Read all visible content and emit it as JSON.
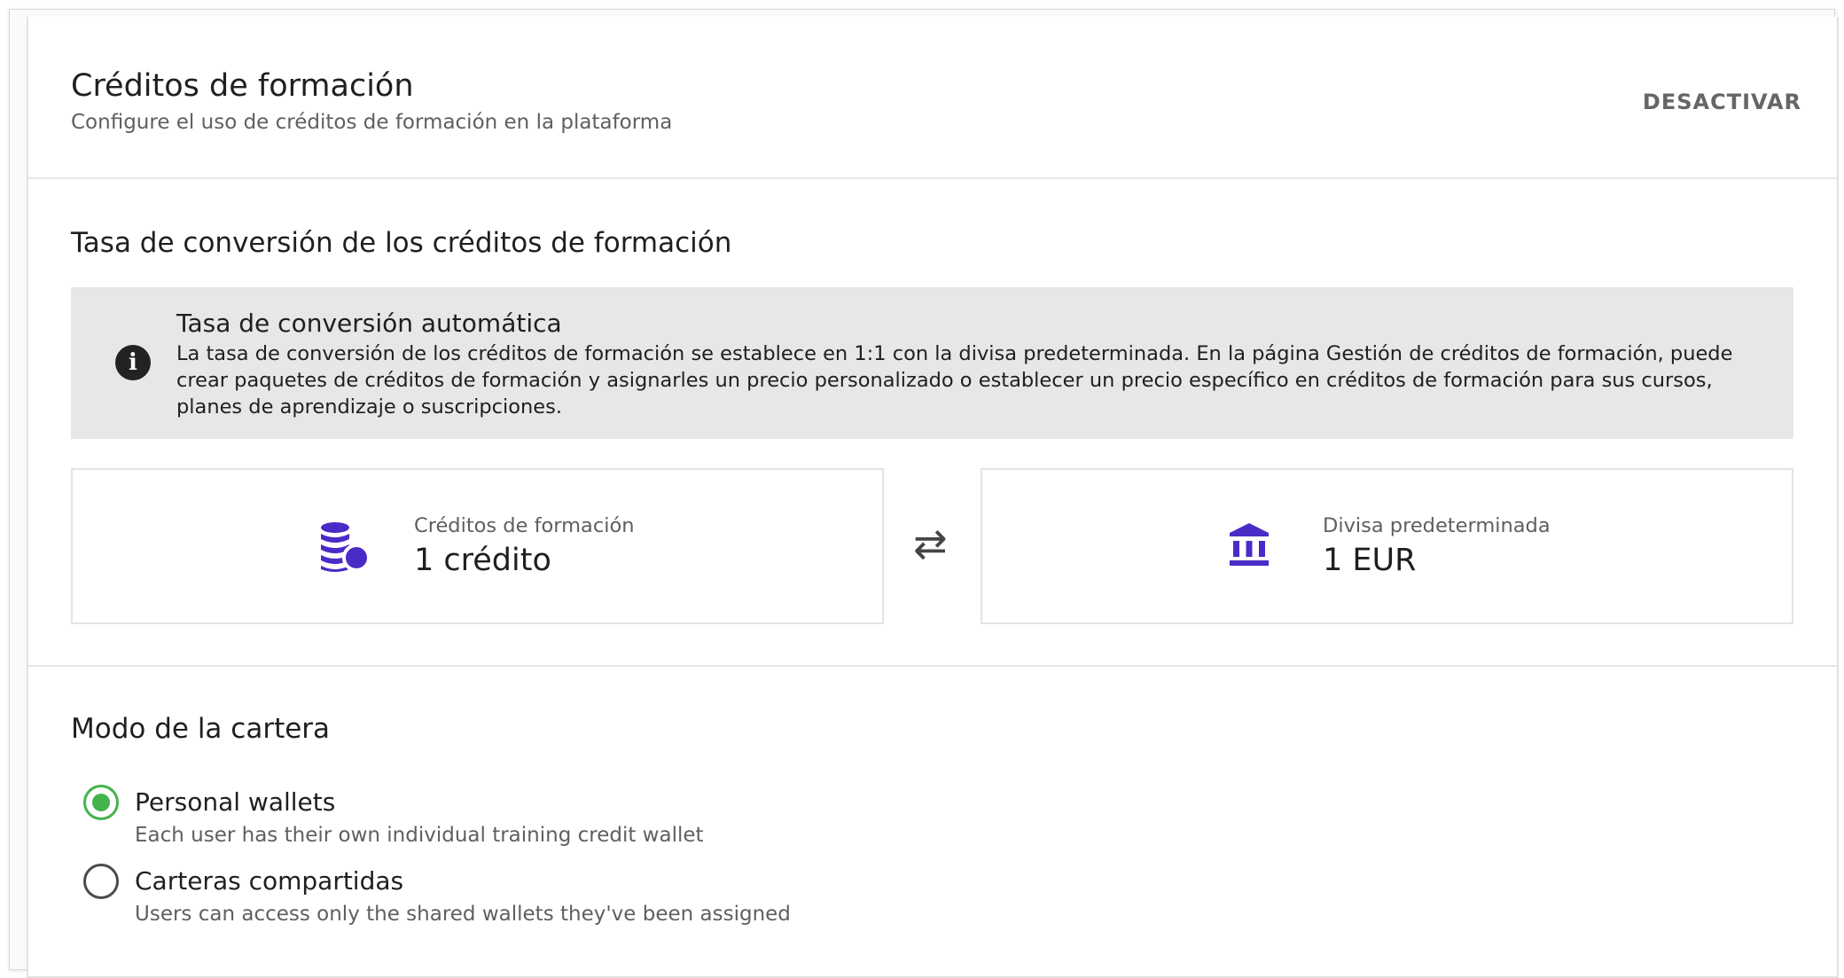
{
  "header": {
    "title": "Créditos de formación",
    "subtitle": "Configure el uso de créditos de formación en la plataforma",
    "deactivate_label": "DESACTIVAR"
  },
  "conversion": {
    "title": "Tasa de conversión de los créditos de formación",
    "info": {
      "icon": "info-icon",
      "title": "Tasa de conversión automática",
      "text": "La tasa de conversión de los créditos de formación se establece en 1:1 con la divisa predeterminada. En la página Gestión de créditos de formación, puede crear paquetes de créditos de formación y asignarles un precio personalizado o establecer un precio específico en créditos de formación para sus cursos, planes de aprendizaje o suscripciones."
    },
    "credits_box": {
      "icon": "coins-icon",
      "label": "Créditos de formación",
      "value": "1 crédito"
    },
    "swap_icon": "swap-arrows-icon",
    "currency_box": {
      "icon": "bank-icon",
      "label": "Divisa predeterminada",
      "value": "1 EUR"
    },
    "accent_color": "#4b2bc7"
  },
  "wallet_mode": {
    "title": "Modo de la cartera",
    "options": [
      {
        "label": "Personal wallets",
        "description": "Each user has their own individual training credit wallet",
        "selected": true
      },
      {
        "label": "Carteras compartidas",
        "description": "Users can access only the shared wallets they've been assigned",
        "selected": false
      }
    ],
    "selected_color": "#43b34b"
  }
}
